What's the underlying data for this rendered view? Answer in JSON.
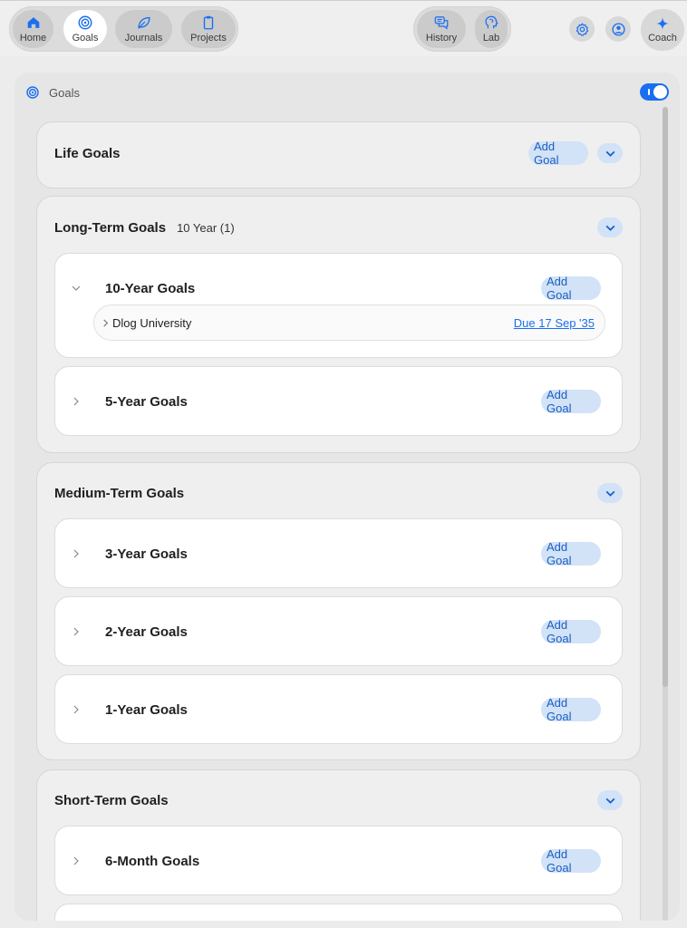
{
  "nav": {
    "left": [
      {
        "label": "Home",
        "icon": "home-icon",
        "active": false
      },
      {
        "label": "Goals",
        "icon": "target-icon",
        "active": true
      },
      {
        "label": "Journals",
        "icon": "leaf-icon",
        "active": false
      }
    ],
    "projects": {
      "label": "Projects",
      "icon": "clipboard-icon"
    },
    "center": [
      {
        "label": "History",
        "icon": "chat-bubbles-icon"
      },
      {
        "label": "Lab",
        "icon": "head-icon"
      }
    ],
    "settings_icon": "gear-icon",
    "profile_icon": "user-circle-icon",
    "coach": {
      "label": "Coach",
      "icon": "sparkle-icon"
    }
  },
  "panel": {
    "title": "Goals",
    "toggle_on": true
  },
  "accent": "#1a6ff0",
  "add_goal_label": "Add Goal",
  "sections": [
    {
      "title": "Life Goals",
      "subtitle": "",
      "has_add_goal": true
    },
    {
      "title": "Long-Term Goals",
      "subtitle": "10 Year (1)",
      "cards": [
        {
          "title": "10-Year Goals",
          "expanded": true,
          "items": [
            {
              "name": "Dlog University",
              "due": "Due 17 Sep '35"
            }
          ]
        },
        {
          "title": "5-Year Goals",
          "expanded": false
        }
      ]
    },
    {
      "title": "Medium-Term Goals",
      "subtitle": "",
      "cards": [
        {
          "title": "3-Year Goals",
          "expanded": false
        },
        {
          "title": "2-Year Goals",
          "expanded": false
        },
        {
          "title": "1-Year Goals",
          "expanded": false
        }
      ]
    },
    {
      "title": "Short-Term Goals",
      "subtitle": "",
      "cards": [
        {
          "title": "6-Month Goals",
          "expanded": false
        }
      ]
    }
  ]
}
